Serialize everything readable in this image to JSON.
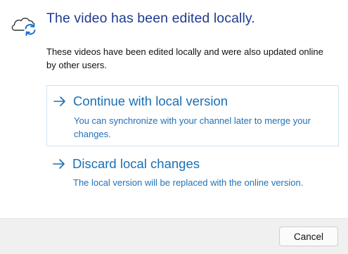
{
  "dialog": {
    "icon": "cloud-sync-icon",
    "title": "The video has been edited locally.",
    "description": "These videos have been edited locally and were also updated online by other users.",
    "options": [
      {
        "icon": "arrow-right-icon",
        "title": "Continue with local version",
        "subtitle": "You can synchronize with your channel later to merge your changes."
      },
      {
        "icon": "arrow-right-icon",
        "title": "Discard local changes",
        "subtitle": "The local version will be replaced with the online version."
      }
    ],
    "cancel_label": "Cancel"
  },
  "colors": {
    "title": "#1f3b8f",
    "option_text": "#1a6fb5",
    "sync_arrows": "#1f72d6",
    "footer_bg": "#f0f0f0"
  }
}
